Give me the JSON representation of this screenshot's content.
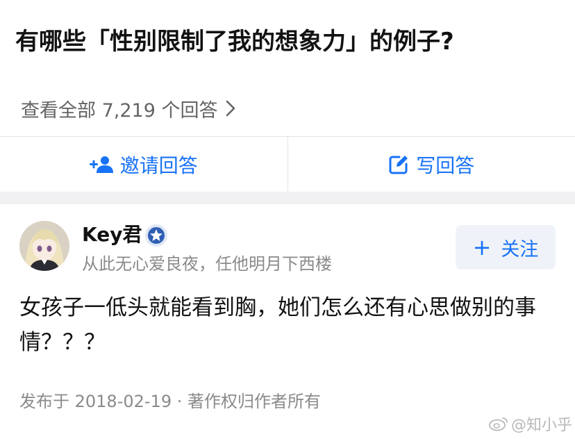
{
  "question": {
    "title": "有哪些「性别限制了我的想象力」的例子?"
  },
  "answers_link": {
    "label": "查看全部 7,219 个回答"
  },
  "actions": {
    "invite_label": "邀请回答",
    "write_label": "写回答"
  },
  "answer": {
    "author": {
      "name": "Key君",
      "bio": "从此无心爱良夜，任他明月下西楼"
    },
    "follow_label": "关注",
    "content": "女孩子一低头就能看到胸，她们怎么还有心思做别的事情？？？",
    "meta": "发布于 2018-02-19 · 著作权归作者所有"
  },
  "watermark": {
    "text": "@知小乎"
  },
  "colors": {
    "accent": "#1772f6",
    "muted": "#8a8a8a",
    "separator": "#f1f1f3"
  }
}
